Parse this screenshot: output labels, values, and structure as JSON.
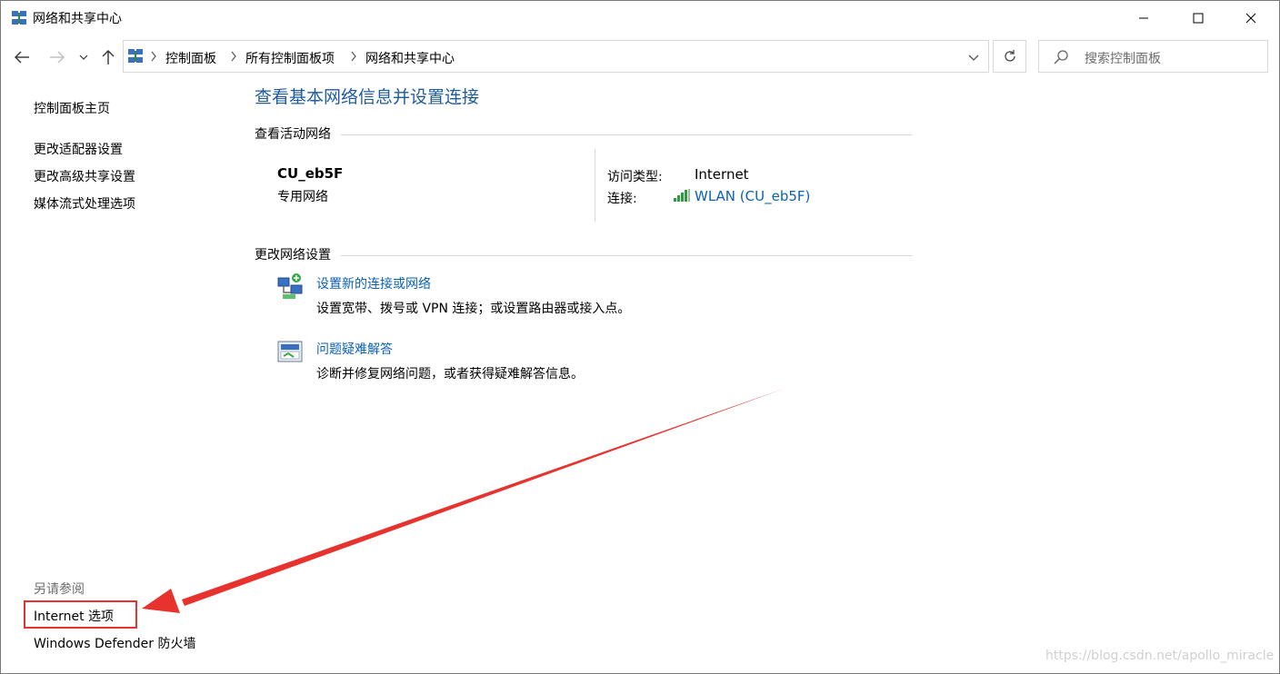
{
  "window": {
    "title": "网络和共享中心",
    "icons": {
      "app": "network-sharing-center-icon",
      "minimize": "minimize-icon",
      "maximize": "maximize-icon",
      "close": "close-icon"
    }
  },
  "navigation": {
    "back": "arrow-left-icon",
    "forward": "arrow-right-icon",
    "recent": "chevron-down-icon",
    "up": "arrow-up-icon",
    "breadcrumbs": [
      "控制面板",
      "所有控制面板项",
      "网络和共享中心"
    ],
    "refresh": "refresh-icon"
  },
  "search": {
    "placeholder": "搜索控制面板"
  },
  "sidebar": {
    "items": [
      {
        "label": "控制面板主页"
      },
      {
        "label": "更改适配器设置"
      },
      {
        "label": "更改高级共享设置"
      },
      {
        "label": "媒体流式处理选项"
      }
    ],
    "see_also_title": "另请参阅",
    "see_also": [
      {
        "label": "Internet 选项"
      },
      {
        "label": "Windows Defender 防火墙"
      }
    ]
  },
  "main": {
    "title": "查看基本网络信息并设置连接",
    "active_networks_heading": "查看活动网络",
    "network": {
      "name": "CU_eb5F",
      "type": "专用网络",
      "access_type_label": "访问类型:",
      "access_type_value": "Internet",
      "connection_label": "连接:",
      "connection_value": "WLAN (CU_eb5F)"
    },
    "change_settings_heading": "更改网络设置",
    "tasks": [
      {
        "label": "设置新的连接或网络",
        "description": "设置宽带、拨号或 VPN 连接；或设置路由器或接入点。",
        "icon": "new-connection-icon"
      },
      {
        "label": "问题疑难解答",
        "description": "诊断并修复网络问题，或者获得疑难解答信息。",
        "icon": "troubleshoot-icon"
      }
    ]
  },
  "annotation": {
    "color": "#e8322d"
  },
  "watermark": "https://blog.csdn.net/apollo_miracle",
  "colors": {
    "link": "#0b61b4",
    "title": "#1e5b9f"
  }
}
